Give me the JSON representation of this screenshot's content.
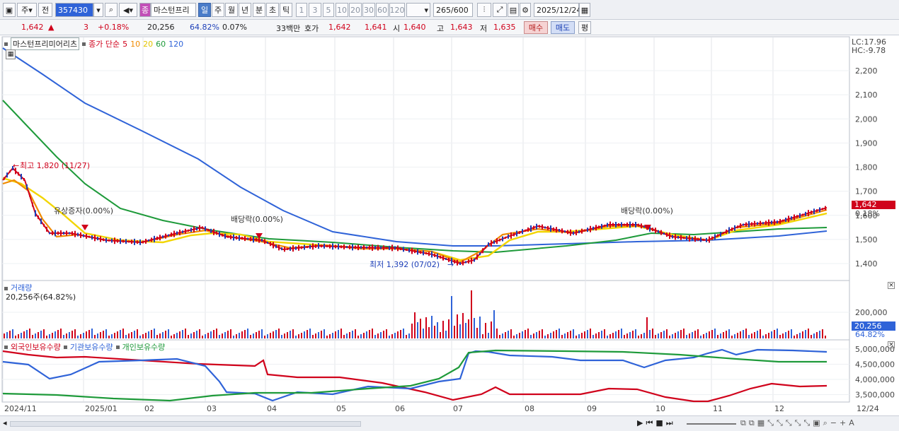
{
  "toolbar": {
    "period": "주",
    "prev": "전",
    "code": "357430",
    "badge": "종",
    "name": "마스턴프리",
    "tabs": [
      "일",
      "주",
      "월",
      "년",
      "분",
      "초",
      "틱"
    ],
    "numbers": [
      "1",
      "3",
      "5",
      "10",
      "20",
      "30",
      "60",
      "120"
    ],
    "count": "265",
    "total": "/600",
    "date": "2025/12/24"
  },
  "quote": {
    "price": "1,642",
    "change": "3",
    "rate": "+0.18%",
    "volume": "20,256",
    "vol_pct": "64.82%",
    "turnover": "0.07%",
    "amount": "33백만",
    "ask_label": "호가",
    "ask1": "1,642",
    "ask2": "1,641",
    "open_label": "시",
    "open": "1,640",
    "high_label": "고",
    "high": "1,643",
    "low_label": "저",
    "low": "1,635",
    "buy": "매수",
    "sell": "매도",
    "avg": "평"
  },
  "price_panel": {
    "name": "마스턴프리미어리츠",
    "legend_type": "종가 단순",
    "ma_labels": [
      "5",
      "10",
      "20",
      "60",
      "120"
    ],
    "ma_colors": [
      "#d0021b",
      "#f08a00",
      "#f2d500",
      "#1e9a3a",
      "#2f63d8"
    ],
    "lc": "LC:17.96",
    "hc": "HC:-9.78",
    "y_ticks": [
      "2,200",
      "2,100",
      "2,000",
      "1,900",
      "1,800",
      "1,700",
      "1,600",
      "1,500",
      "1,400"
    ],
    "last_price_tag": "1,642",
    "last_rate_tag": "0.18%",
    "annotations": {
      "high": "최고 1,820 (11/27)",
      "low": "최저 1,392 (07/02)",
      "rights": "유상증자(0.00%)",
      "div1": "배당락(0.00%)",
      "div2": "배당락(0.00%)"
    }
  },
  "volume_panel": {
    "title": "거래량",
    "value": "20,256주(64.82%)",
    "y_tick": "200,000",
    "tag_value": "20,256",
    "tag_pct": "64.82%"
  },
  "holding_panel": {
    "legend": [
      "외국인보유수량",
      "기관보유수량",
      "개인보유수량"
    ],
    "legend_colors": [
      "#d0021b",
      "#2f63d8",
      "#1e9a3a"
    ],
    "y_ticks": [
      "5,000,000",
      "4,500,000",
      "4,000,000",
      "3,500,000"
    ]
  },
  "xaxis": {
    "labels": [
      "2024/11",
      "2025/01",
      "02",
      "03",
      "04",
      "05",
      "06",
      "07",
      "08",
      "09",
      "10",
      "11",
      "12"
    ],
    "right_label": "12/24"
  }
}
